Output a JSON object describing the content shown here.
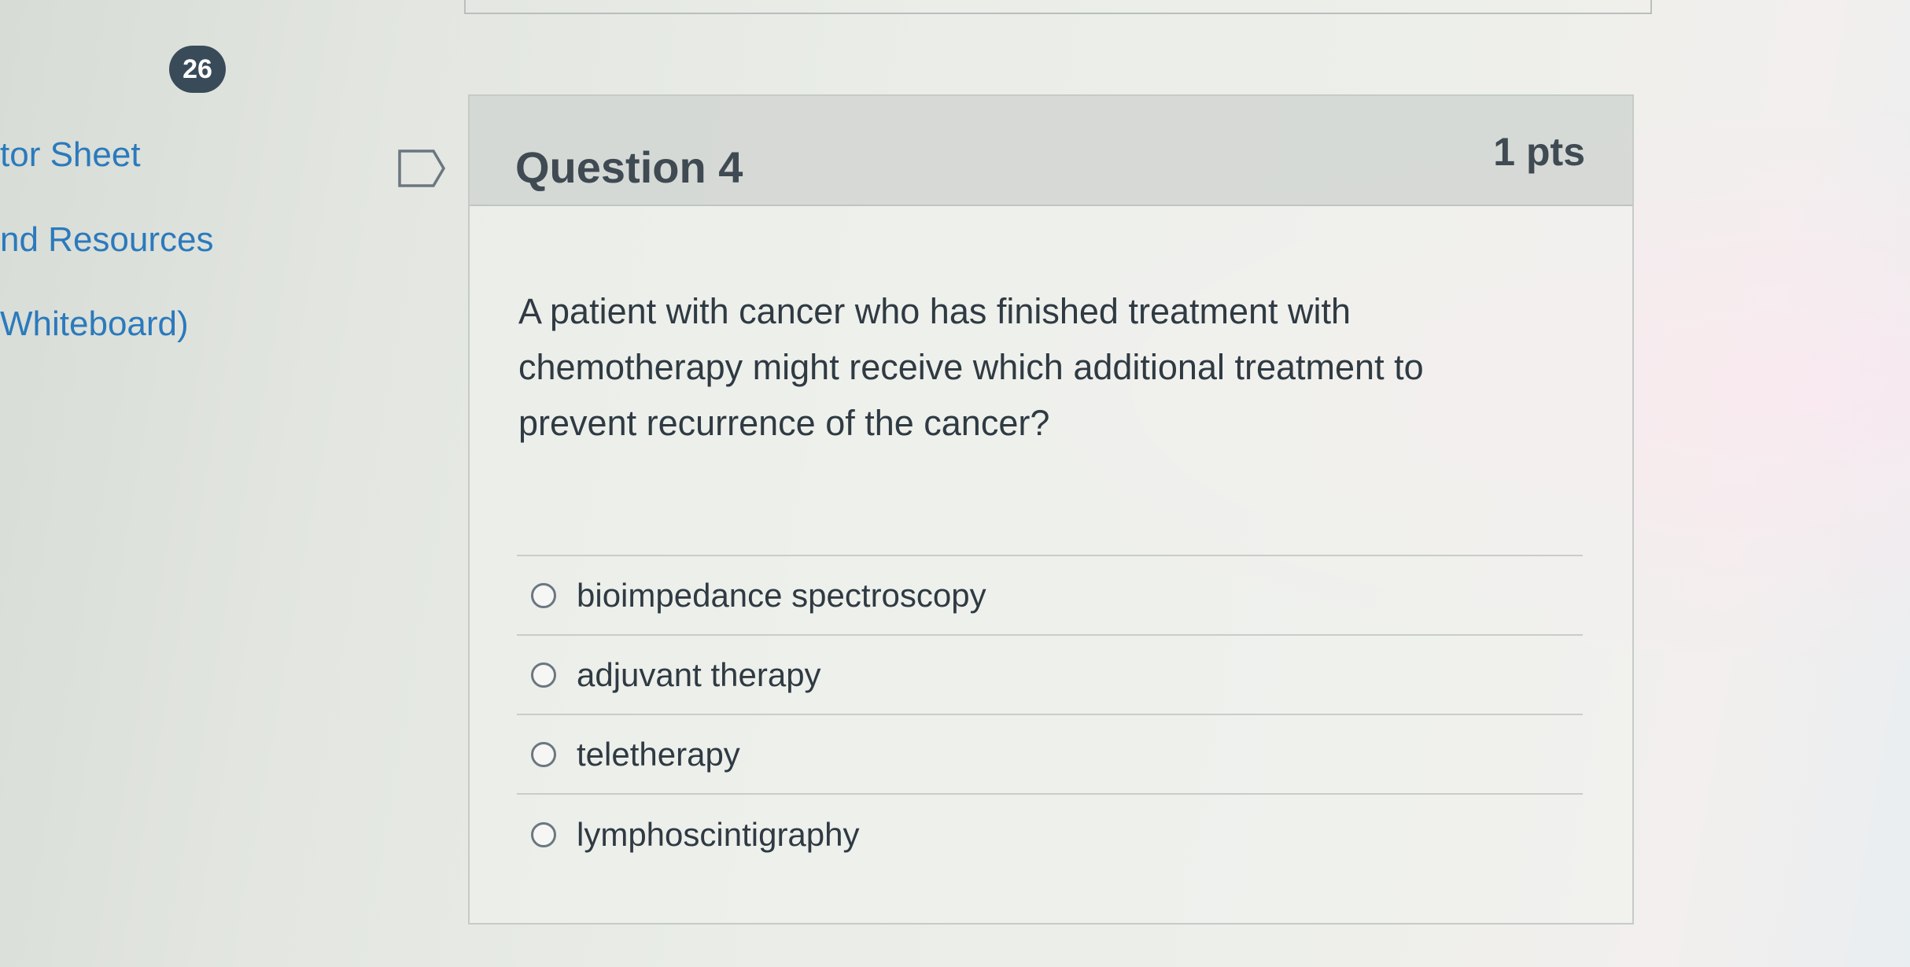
{
  "nav": {
    "badge_count": "26",
    "sidebar_links": [
      "tor Sheet",
      "nd Resources",
      "Whiteboard)"
    ]
  },
  "question": {
    "title": "Question 4",
    "points": "1 pts",
    "text": "A patient with cancer who has finished treatment with chemotherapy might receive which additional treatment to prevent recurrence of the cancer?",
    "answers": [
      {
        "label": "bioimpedance spectroscopy",
        "selected": false
      },
      {
        "label": "adjuvant therapy",
        "selected": false
      },
      {
        "label": "teletherapy",
        "selected": false
      },
      {
        "label": "lymphoscintigraphy",
        "selected": false
      }
    ]
  },
  "colors": {
    "link": "#2b7abc",
    "badge": "#394b58",
    "text": "#2f3a42"
  },
  "icons": [
    "flag-question-icon",
    "radio-icon"
  ]
}
